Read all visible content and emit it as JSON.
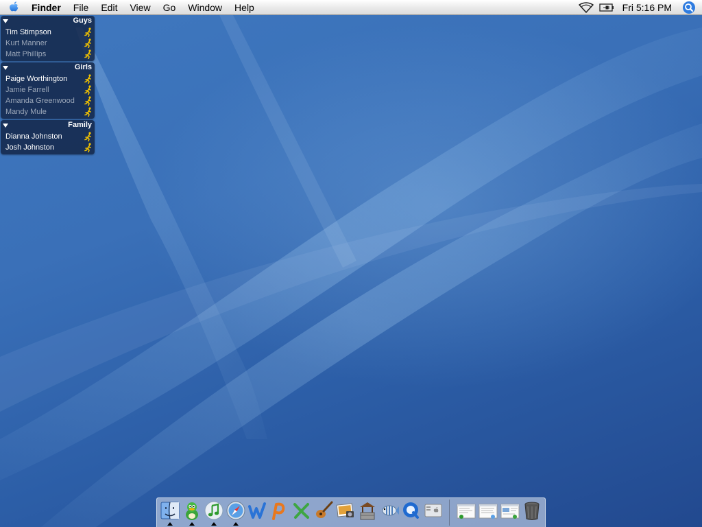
{
  "menubar": {
    "app_name": "Finder",
    "items": [
      "File",
      "Edit",
      "View",
      "Go",
      "Window",
      "Help"
    ],
    "clock": "Fri 5:16 PM",
    "icons": [
      "apple-icon",
      "wifi-icon",
      "battery-icon",
      "spotlight-icon"
    ]
  },
  "buddy_list": {
    "groups": [
      {
        "name": "Guys",
        "buddies": [
          {
            "name": "Tim Stimpson",
            "status": "active"
          },
          {
            "name": "Kurt Manner",
            "status": "idle"
          },
          {
            "name": "Matt Phillips",
            "status": "idle"
          }
        ]
      },
      {
        "name": "Girls",
        "buddies": [
          {
            "name": "Paige Worthington",
            "status": "active"
          },
          {
            "name": "Jamie Farrell",
            "status": "idle"
          },
          {
            "name": "Amanda Greenwood",
            "status": "idle"
          },
          {
            "name": "Mandy Mule",
            "status": "idle"
          }
        ]
      },
      {
        "name": "Family",
        "buddies": [
          {
            "name": "Dianna Johnston",
            "status": "active"
          },
          {
            "name": "Josh Johnston",
            "status": "active"
          }
        ]
      }
    ]
  },
  "dock": {
    "apps": [
      {
        "icon": "finder-icon",
        "running": true
      },
      {
        "icon": "adium-duck-icon",
        "running": true
      },
      {
        "icon": "itunes-icon",
        "running": true
      },
      {
        "icon": "safari-icon",
        "running": true
      },
      {
        "icon": "word-icon",
        "running": false
      },
      {
        "icon": "powerpoint-icon",
        "running": false
      },
      {
        "icon": "excel-icon",
        "running": false
      },
      {
        "icon": "garageband-icon",
        "running": false
      },
      {
        "icon": "iphoto-icon",
        "running": false
      },
      {
        "icon": "wishing-well-icon",
        "running": false
      },
      {
        "icon": "fish-icon",
        "running": false
      },
      {
        "icon": "quicktime-icon",
        "running": false
      },
      {
        "icon": "system-preferences-icon",
        "running": false
      }
    ],
    "documents": [
      {
        "icon": "minimized-window-icon"
      },
      {
        "icon": "minimized-window-icon"
      },
      {
        "icon": "minimized-window-icon"
      },
      {
        "icon": "trash-icon"
      }
    ]
  }
}
